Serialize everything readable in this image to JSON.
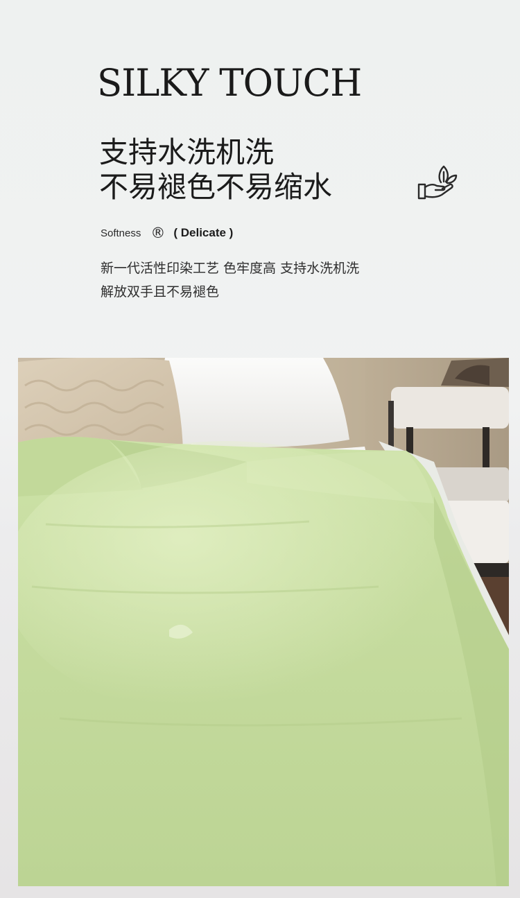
{
  "brand": {
    "title": "SILKY TOUCH"
  },
  "headline": {
    "line1": "支持水洗机洗",
    "line2": "不易褪色不易缩水"
  },
  "tag": {
    "softness": "Softness",
    "mark": "®",
    "delicate": "( Delicate )"
  },
  "description": {
    "line1": "新一代活性印染工艺 色牢度高 支持水洗机洗",
    "line2": "解放双手且不易褪色"
  },
  "icons": {
    "care": "hand-leaf-icon"
  },
  "colors": {
    "background": "#eef1f0",
    "text": "#1f1f1f",
    "duvet": "#c9dea4",
    "pillow_beige": "#d8c8b0",
    "pillow_white": "#f4f3f1"
  }
}
